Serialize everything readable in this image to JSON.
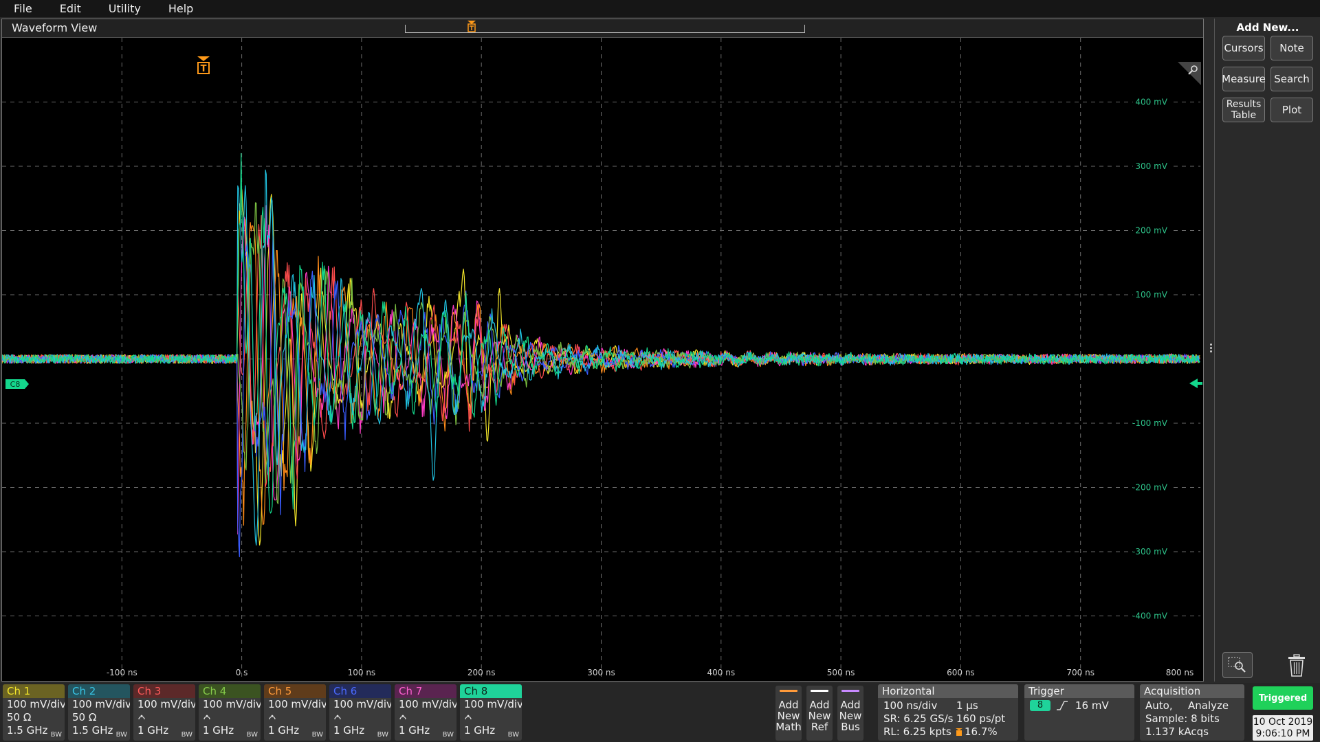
{
  "menu": [
    "File",
    "Edit",
    "Utility",
    "Help"
  ],
  "waveform_view": {
    "title": "Waveform View",
    "trigger_marker": "T",
    "channel_marker": "C8"
  },
  "side_panel": {
    "title": "Add New...",
    "buttons": [
      "Cursors",
      "Note",
      "Measure",
      "Search",
      "Results Table",
      "Plot"
    ],
    "icons": [
      "zoom-icon",
      "trash-icon"
    ]
  },
  "chart_data": {
    "type": "line",
    "title": "",
    "xlabel": "",
    "ylabel": "",
    "x_ticks": [
      "-100 ns",
      "0 s",
      "100 ns",
      "200 ns",
      "300 ns",
      "400 ns",
      "500 ns",
      "600 ns",
      "700 ns",
      "800 ns"
    ],
    "y_ticks": [
      "400 mV",
      "300 mV",
      "200 mV",
      "100 mV",
      "-100 mV",
      "-200 mV",
      "-300 mV",
      "-400 mV"
    ],
    "xlim_ns": [
      -200,
      800
    ],
    "ylim_mV": [
      -500,
      500
    ],
    "grid": true,
    "trigger_time_ns": 0,
    "series": [
      {
        "name": "Ch 1",
        "color": "#f4e62a",
        "peaks": [
          {
            "t_ns": 2,
            "mV": 220
          },
          {
            "t_ns": 15,
            "mV": -290
          },
          {
            "t_ns": 45,
            "mV": -260
          },
          {
            "t_ns": 95,
            "mV": 80
          },
          {
            "t_ns": 185,
            "mV": 140
          },
          {
            "t_ns": 205,
            "mV": -130
          },
          {
            "t_ns": 215,
            "mV": 110
          }
        ]
      },
      {
        "name": "Ch 2",
        "color": "#21c2e0",
        "peaks": [
          {
            "t_ns": 3,
            "mV": 270
          },
          {
            "t_ns": 12,
            "mV": -290
          },
          {
            "t_ns": 25,
            "mV": 255
          },
          {
            "t_ns": 160,
            "mV": -190
          },
          {
            "t_ns": 150,
            "mV": 110
          }
        ]
      },
      {
        "name": "Ch 3",
        "color": "#ff4d4d",
        "peaks": [
          {
            "t_ns": 5,
            "mV": 150
          },
          {
            "t_ns": 20,
            "mV": -200
          },
          {
            "t_ns": 110,
            "mV": 110
          }
        ]
      },
      {
        "name": "Ch 4",
        "color": "#7cc242",
        "peaks": [
          {
            "t_ns": 8,
            "mV": 180
          },
          {
            "t_ns": 30,
            "mV": -230
          }
        ]
      },
      {
        "name": "Ch 5",
        "color": "#ff8c1a",
        "peaks": [
          {
            "t_ns": 10,
            "mV": 200
          },
          {
            "t_ns": 18,
            "mV": -260
          },
          {
            "t_ns": 140,
            "mV": 80
          }
        ]
      },
      {
        "name": "Ch 6",
        "color": "#3a5cff",
        "peaks": [
          {
            "t_ns": 6,
            "mV": 140
          },
          {
            "t_ns": 22,
            "mV": -180
          }
        ]
      },
      {
        "name": "Ch 7",
        "color": "#ff3dc7",
        "peaks": [
          {
            "t_ns": 4,
            "mV": 160
          },
          {
            "t_ns": 28,
            "mV": -220
          }
        ]
      },
      {
        "name": "Ch 8",
        "color": "#14d78c",
        "peaks": [
          {
            "t_ns": 7,
            "mV": 190
          },
          {
            "t_ns": 24,
            "mV": -240
          }
        ]
      }
    ]
  },
  "channels": [
    {
      "name": "Ch 1",
      "color": "#f4e62a",
      "hdr_bg": "#6b6323",
      "scale": "100 mV/div",
      "line2": "50 Ω",
      "bw": "1.5 GHz",
      "probe": false
    },
    {
      "name": "Ch 2",
      "color": "#38c6e6",
      "hdr_bg": "#24555f",
      "scale": "100 mV/div",
      "line2": "50 Ω",
      "bw": "1.5 GHz",
      "probe": false
    },
    {
      "name": "Ch 3",
      "color": "#ff5a5a",
      "hdr_bg": "#5c2929",
      "scale": "100 mV/div",
      "line2": "",
      "bw": "1 GHz",
      "probe": true
    },
    {
      "name": "Ch 4",
      "color": "#86cc4a",
      "hdr_bg": "#3b5321",
      "scale": "100 mV/div",
      "line2": "",
      "bw": "1 GHz",
      "probe": true
    },
    {
      "name": "Ch 5",
      "color": "#ff9a3a",
      "hdr_bg": "#5f3c1b",
      "scale": "100 mV/div",
      "line2": "",
      "bw": "1 GHz",
      "probe": true
    },
    {
      "name": "Ch 6",
      "color": "#4a6aff",
      "hdr_bg": "#232b5a",
      "scale": "100 mV/div",
      "line2": "",
      "bw": "1 GHz",
      "probe": true
    },
    {
      "name": "Ch 7",
      "color": "#ff5fd0",
      "hdr_bg": "#5a2450",
      "scale": "100 mV/div",
      "line2": "",
      "bw": "1 GHz",
      "probe": true
    },
    {
      "name": "Ch 8",
      "color": "#ffffff",
      "hdr_bg": "#1fd39a",
      "hdr_text": "#0c2a1e",
      "scale": "100 mV/div",
      "line2": "",
      "bw": "1 GHz",
      "probe": true
    }
  ],
  "bw_badge": "BW",
  "add_buttons": [
    {
      "label": "Add New Math",
      "color": "#ff9a3a"
    },
    {
      "label": "Add New Ref",
      "color": "#ffffff"
    },
    {
      "label": "Add New Bus",
      "color": "#c88aff"
    }
  ],
  "horizontal": {
    "title": "Horizontal",
    "scale": "100 ns/div",
    "record_time": "1 µs",
    "sample_rate": "SR: 6.25 GS/s",
    "resolution": "160 ps/pt",
    "record_length": "RL: 6.25 kpts",
    "position": "16.7%"
  },
  "trigger": {
    "title": "Trigger",
    "source": "8",
    "level": "16 mV"
  },
  "acquisition": {
    "title": "Acquisition",
    "mode": "Auto,",
    "analyze": "Analyze",
    "sample": "Sample: 8 bits",
    "acqs": "1.137 kAcqs"
  },
  "status": {
    "triggered": "Triggered",
    "date": "10 Oct 2019",
    "time": "9:06:10 PM"
  }
}
